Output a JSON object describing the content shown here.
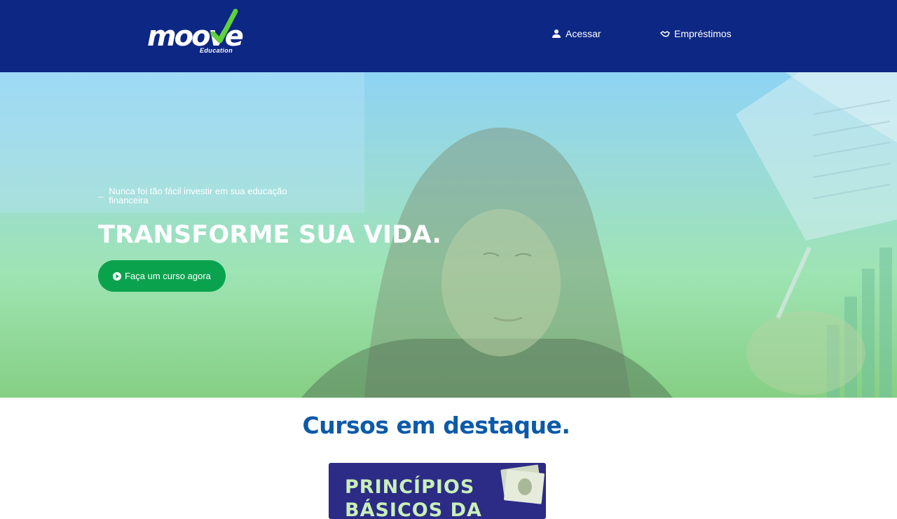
{
  "header": {
    "logo_text": "moove",
    "logo_sub": "Education",
    "nav": [
      {
        "label": "Acessar",
        "icon": "user-icon"
      },
      {
        "label": "Empréstimos",
        "icon": "handshake-icon"
      }
    ]
  },
  "hero": {
    "tagline": "Nunca foi tão fácil investir em sua educação financeira",
    "headline": "TRANSFORME SUA VIDA.",
    "cta_label": "Faça um curso agora",
    "cta_icon": "play-circle-icon"
  },
  "featured": {
    "title": "Cursos em destaque.",
    "courses": [
      {
        "title_line1": "PRINCÍPIOS",
        "title_line2": "BÁSICOS DA"
      }
    ]
  },
  "colors": {
    "header_bg": "#0d2784",
    "cta_bg": "#0ba24e",
    "section_title": "#0d5aa8",
    "card_bg": "#2c2b86"
  }
}
